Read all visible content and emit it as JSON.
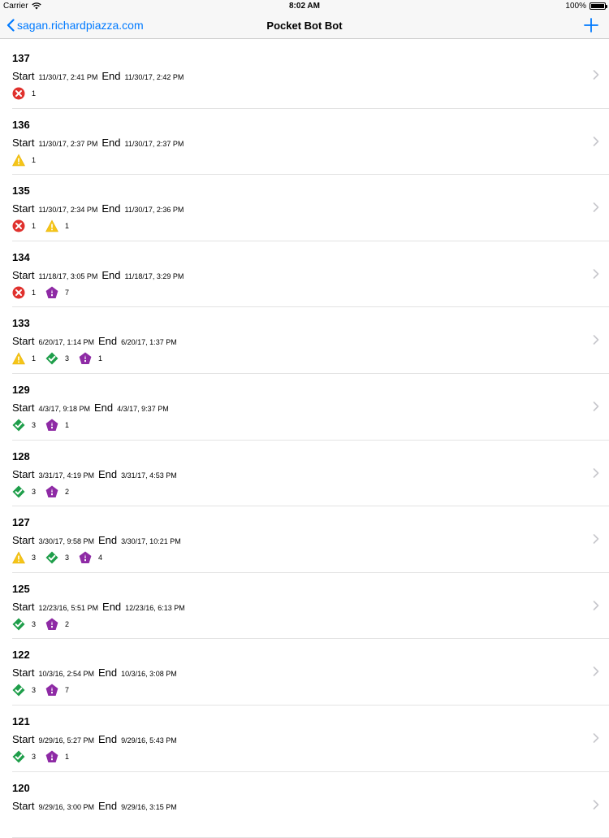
{
  "status": {
    "carrier": "Carrier",
    "time": "8:02 AM",
    "battery": "100%"
  },
  "nav": {
    "back_label": "sagan.richardpiazza.com",
    "title": "Pocket Bot Bot"
  },
  "labels": {
    "start": "Start",
    "end": "End"
  },
  "colors": {
    "accent": "#007aff",
    "error": "#e0312d",
    "warning": "#f5c518",
    "success": "#1e9e4a",
    "analyzer": "#8e2aa5"
  },
  "rows": [
    {
      "number": "137",
      "start": "11/30/17, 2:41 PM",
      "end": "11/30/17, 2:42 PM",
      "issues": [
        {
          "icon": "error-icon",
          "count": "1"
        }
      ]
    },
    {
      "number": "136",
      "start": "11/30/17, 2:37 PM",
      "end": "11/30/17, 2:37 PM",
      "issues": [
        {
          "icon": "warning-icon",
          "count": "1"
        }
      ]
    },
    {
      "number": "135",
      "start": "11/30/17, 2:34 PM",
      "end": "11/30/17, 2:36 PM",
      "issues": [
        {
          "icon": "error-icon",
          "count": "1"
        },
        {
          "icon": "warning-icon",
          "count": "1"
        }
      ]
    },
    {
      "number": "134",
      "start": "11/18/17, 3:05 PM",
      "end": "11/18/17, 3:29 PM",
      "issues": [
        {
          "icon": "error-icon",
          "count": "1"
        },
        {
          "icon": "analyzer-icon",
          "count": "7"
        }
      ]
    },
    {
      "number": "133",
      "start": "6/20/17, 1:14 PM",
      "end": "6/20/17, 1:37 PM",
      "issues": [
        {
          "icon": "warning-icon",
          "count": "1"
        },
        {
          "icon": "success-icon",
          "count": "3"
        },
        {
          "icon": "analyzer-icon",
          "count": "1"
        }
      ]
    },
    {
      "number": "129",
      "start": "4/3/17, 9:18 PM",
      "end": "4/3/17, 9:37 PM",
      "issues": [
        {
          "icon": "success-icon",
          "count": "3"
        },
        {
          "icon": "analyzer-icon",
          "count": "1"
        }
      ]
    },
    {
      "number": "128",
      "start": "3/31/17, 4:19 PM",
      "end": "3/31/17, 4:53 PM",
      "issues": [
        {
          "icon": "success-icon",
          "count": "3"
        },
        {
          "icon": "analyzer-icon",
          "count": "2"
        }
      ]
    },
    {
      "number": "127",
      "start": "3/30/17, 9:58 PM",
      "end": "3/30/17, 10:21 PM",
      "issues": [
        {
          "icon": "warning-icon",
          "count": "3"
        },
        {
          "icon": "success-icon",
          "count": "3"
        },
        {
          "icon": "analyzer-icon",
          "count": "4"
        }
      ]
    },
    {
      "number": "125",
      "start": "12/23/16, 5:51 PM",
      "end": "12/23/16, 6:13 PM",
      "issues": [
        {
          "icon": "success-icon",
          "count": "3"
        },
        {
          "icon": "analyzer-icon",
          "count": "2"
        }
      ]
    },
    {
      "number": "122",
      "start": "10/3/16, 2:54 PM",
      "end": "10/3/16, 3:08 PM",
      "issues": [
        {
          "icon": "success-icon",
          "count": "3"
        },
        {
          "icon": "analyzer-icon",
          "count": "7"
        }
      ]
    },
    {
      "number": "121",
      "start": "9/29/16, 5:27 PM",
      "end": "9/29/16, 5:43 PM",
      "issues": [
        {
          "icon": "success-icon",
          "count": "3"
        },
        {
          "icon": "analyzer-icon",
          "count": "1"
        }
      ]
    },
    {
      "number": "120",
      "start": "9/29/16, 3:00 PM",
      "end": "9/29/16, 3:15 PM",
      "issues": []
    }
  ]
}
